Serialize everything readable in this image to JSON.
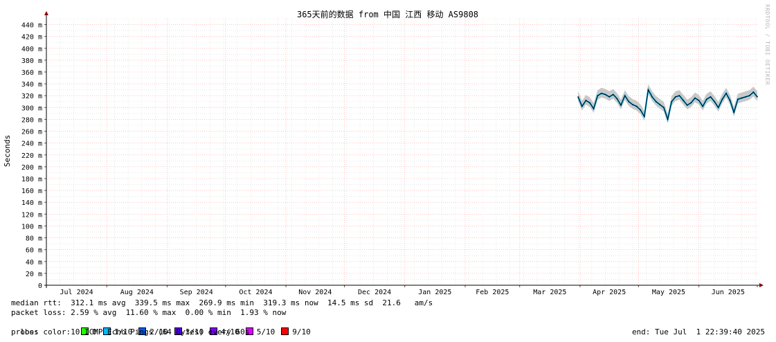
{
  "chart_data": {
    "type": "line",
    "title": "365天前的数据 from 中国 江西 移动 AS9808",
    "ylabel": "Seconds",
    "xlabel": "",
    "ylim": [
      0,
      450
    ],
    "ytick_values": [
      0,
      20,
      40,
      60,
      80,
      100,
      120,
      140,
      160,
      180,
      200,
      220,
      240,
      260,
      280,
      300,
      320,
      340,
      360,
      380,
      400,
      420,
      440
    ],
    "ytick_labels": [
      "0",
      "20 m",
      "40 m",
      "60 m",
      "80 m",
      "100 m",
      "120 m",
      "140 m",
      "160 m",
      "180 m",
      "200 m",
      "220 m",
      "240 m",
      "260 m",
      "280 m",
      "300 m",
      "320 m",
      "340 m",
      "360 m",
      "380 m",
      "400 m",
      "420 m",
      "440 m"
    ],
    "x_range": [
      "2024-07-01",
      "2025-07-01"
    ],
    "month_ticks": [
      {
        "date": "2024-07-01",
        "label": "Jul 2024"
      },
      {
        "date": "2024-08-01",
        "label": "Aug 2024"
      },
      {
        "date": "2024-09-01",
        "label": "Sep 2024"
      },
      {
        "date": "2024-10-01",
        "label": "Oct 2024"
      },
      {
        "date": "2024-11-01",
        "label": "Nov 2024"
      },
      {
        "date": "2024-12-01",
        "label": "Dec 2024"
      },
      {
        "date": "2025-01-01",
        "label": "Jan 2025"
      },
      {
        "date": "2025-02-01",
        "label": "Feb 2025"
      },
      {
        "date": "2025-03-01",
        "label": "Mar 2025"
      },
      {
        "date": "2025-04-01",
        "label": "Apr 2025"
      },
      {
        "date": "2025-05-01",
        "label": "May 2025"
      },
      {
        "date": "2025-06-01",
        "label": "Jun 2025"
      },
      {
        "date": "2025-07-01",
        "label": ""
      }
    ],
    "series": [
      {
        "color": "#000000",
        "x": [
          "2025-03-31",
          "2025-04-02",
          "2025-04-04",
          "2025-04-06",
          "2025-04-08",
          "2025-04-10",
          "2025-04-12",
          "2025-04-14",
          "2025-04-16",
          "2025-04-18",
          "2025-04-20",
          "2025-04-22",
          "2025-04-24",
          "2025-04-26",
          "2025-04-28",
          "2025-04-30",
          "2025-05-02",
          "2025-05-04",
          "2025-05-06",
          "2025-05-08",
          "2025-05-10",
          "2025-05-12",
          "2025-05-14",
          "2025-05-16",
          "2025-05-18",
          "2025-05-20",
          "2025-05-22",
          "2025-05-24",
          "2025-05-26",
          "2025-05-28",
          "2025-05-30",
          "2025-06-01",
          "2025-06-03",
          "2025-06-05",
          "2025-06-07",
          "2025-06-09",
          "2025-06-11",
          "2025-06-13",
          "2025-06-15",
          "2025-06-17",
          "2025-06-19",
          "2025-06-21",
          "2025-06-23",
          "2025-06-25",
          "2025-06-27",
          "2025-06-29",
          "2025-07-01"
        ],
        "y": [
          318,
          302,
          312,
          308,
          298,
          320,
          324,
          322,
          318,
          322,
          315,
          304,
          320,
          310,
          305,
          302,
          296,
          285,
          330,
          318,
          310,
          305,
          300,
          280,
          310,
          318,
          320,
          312,
          304,
          308,
          316,
          312,
          302,
          314,
          318,
          310,
          300,
          314,
          324,
          312,
          292,
          314,
          316,
          318,
          320,
          326,
          318
        ]
      }
    ],
    "grid": true
  },
  "legend": {
    "median_rtt": "median rtt:  312.1 ms avg  339.5 ms max  269.9 ms min  319.3 ms now  14.5 ms sd  21.6   am/s",
    "packet_loss": "packet loss: 2.59 % avg  11.60 % max  0.00 % min  1.93 % now",
    "loss_color_label": "loss color:",
    "loss_colors": [
      {
        "label": "0",
        "color": "#26ff00"
      },
      {
        "label": "1/10",
        "color": "#00b8ff"
      },
      {
        "label": "2/10",
        "color": "#0059ff"
      },
      {
        "label": "3/10",
        "color": "#5e00ff"
      },
      {
        "label": "4/10",
        "color": "#7e00ff"
      },
      {
        "label": "5/10",
        "color": "#dd00ff"
      },
      {
        "label": "9/10",
        "color": "#ff0000"
      }
    ],
    "probe": "probe:       10 ICMP Echo Pings (64 Bytes) every 60s",
    "end": "end: Tue Jul  1 22:39:40 2025"
  },
  "watermark": "RRDTOOL / TOBI OETIKER"
}
